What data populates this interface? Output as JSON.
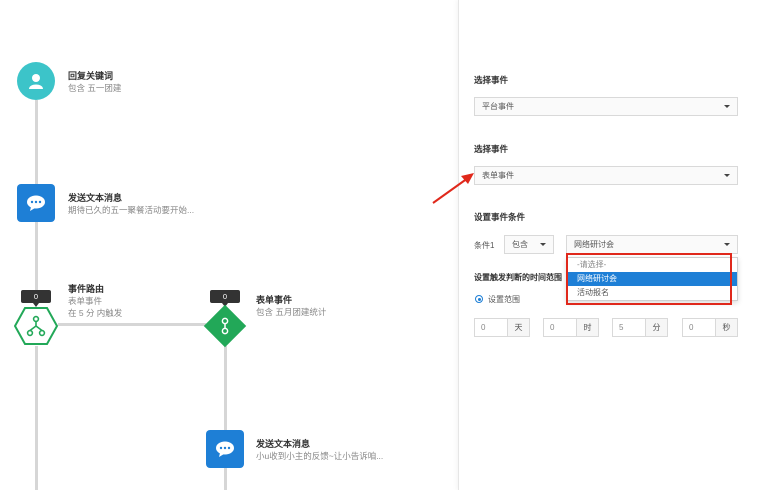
{
  "flow": {
    "node1": {
      "title": "回复关键词",
      "desc": "包含 五一团建",
      "icon": "user-icon"
    },
    "node2": {
      "title": "发送文本消息",
      "desc": "期待已久的五一聚餐活动要开始...",
      "icon": "chat-bubble-icon"
    },
    "node3": {
      "title": "事件路由",
      "desc1": "表单事件",
      "desc2": "在 5 分 内触发",
      "badge": "0",
      "icon": "branch-icon"
    },
    "node4": {
      "title": "表单事件",
      "desc": "包含 五月团建统计",
      "badge": "0",
      "icon": "form-key-icon"
    },
    "node5": {
      "title": "发送文本消息",
      "desc": "小u收到小主的反馈~让小告诉咱...",
      "icon": "chat-bubble-icon"
    }
  },
  "panel": {
    "select_event_label_1": "选择事件",
    "platform_event": "平台事件",
    "select_event_label_2": "选择事件",
    "form_event": "表单事件",
    "condition_section_label": "设置事件条件",
    "condition_label": "条件1",
    "operator_value": "包含",
    "condition_value": "网络研讨会",
    "dropdown_options": [
      "-请选择-",
      "网络研讨会",
      "活动报名"
    ],
    "trigger_time_label": "设置触发判断的时间范围",
    "radio_label": "设置范围",
    "time_fields": [
      {
        "value": "0",
        "unit": "天"
      },
      {
        "value": "0",
        "unit": "时"
      },
      {
        "value": "5",
        "unit": "分"
      },
      {
        "value": "0",
        "unit": "秒"
      }
    ]
  },
  "colors": {
    "accent_blue": "#1e7fd6",
    "teal": "#3cc4c9",
    "route_green": "#22a858",
    "annotation_red": "#e0281b"
  }
}
